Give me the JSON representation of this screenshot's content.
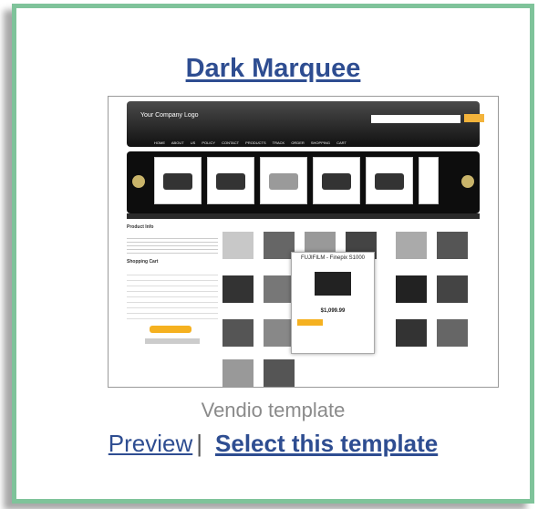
{
  "card": {
    "title": "Dark Marquee",
    "caption": "Vendio template",
    "preview_label": "Preview",
    "separator": "|",
    "select_label": "Select this template"
  },
  "thumbnail": {
    "logo_text": "Your Company Logo",
    "nav_text": "HOME  ABOUT US  POLICY  CONTACT  PRODUCTS  TRACK ORDER  SHOPPING CART",
    "product_info_title": "Product Info",
    "shopping_cart_title": "Shopping Cart",
    "popup_title": "FUJIFILM - Finepix S1000",
    "popup_price": "$1,099.99"
  },
  "colors": {
    "frame_border": "#7fc39a",
    "link": "#2e4d91",
    "caption": "#8a8a8a"
  }
}
